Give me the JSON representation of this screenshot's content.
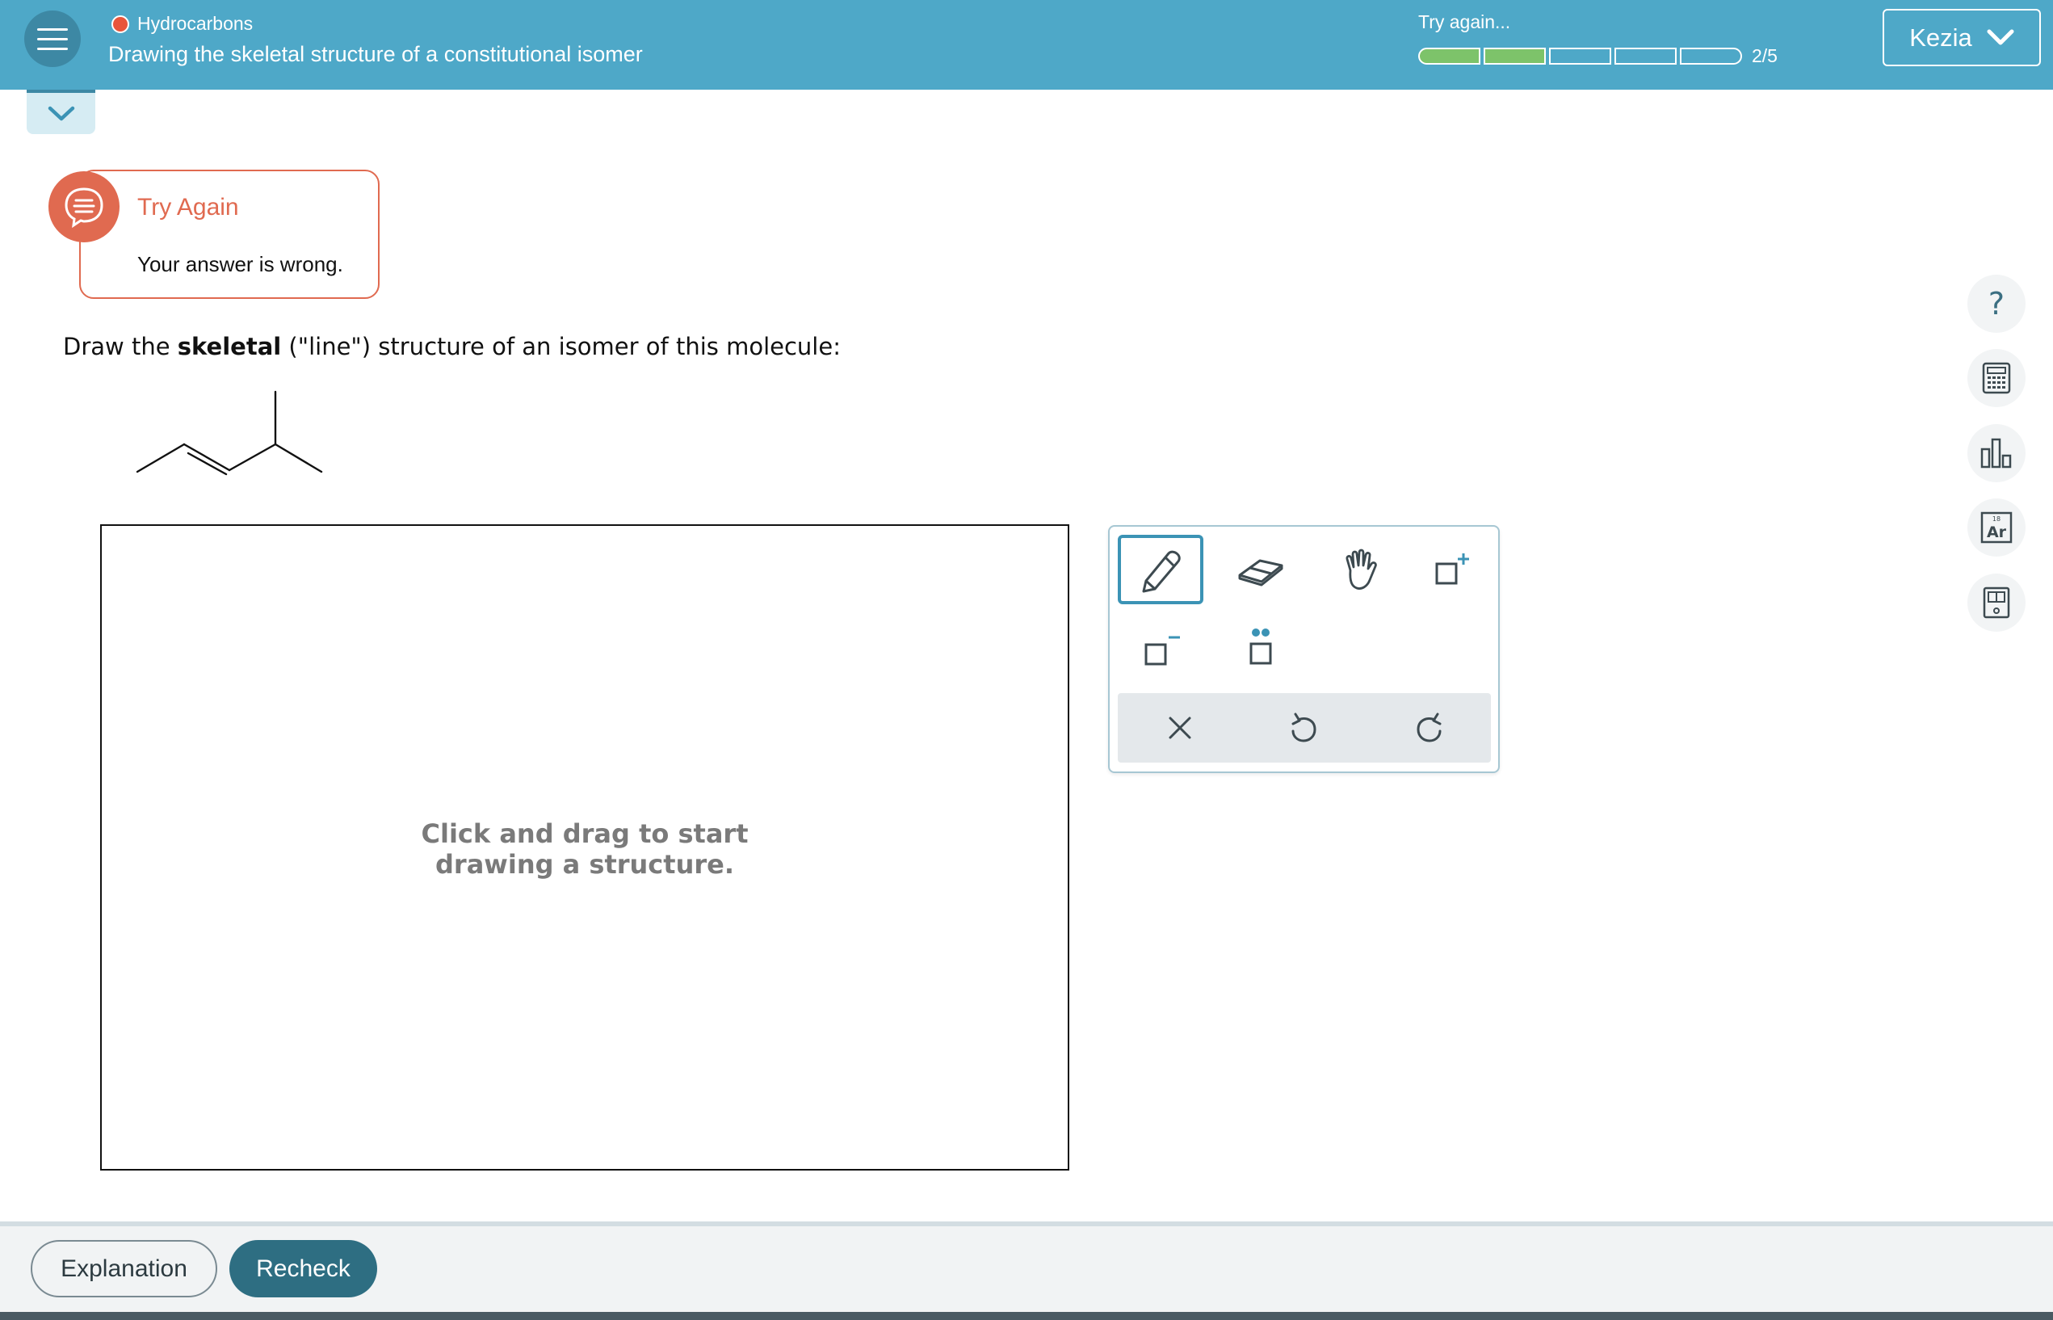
{
  "header": {
    "topic": "Hydrocarbons",
    "title": "Drawing the skeletal structure of a constitutional isomer",
    "progress_status": "Try again...",
    "progress_count": "2/5",
    "progress": {
      "filled": 2,
      "total": 5
    },
    "user_name": "Kezia",
    "colors": {
      "bar": "#4ea8c8",
      "progress_fill": "#7dc36a",
      "status_dot": "#e8553b"
    }
  },
  "feedback": {
    "title": "Try Again",
    "message": "Your answer is wrong.",
    "color": "#e06a50"
  },
  "question": {
    "prefix": "Draw the ",
    "bold": "skeletal",
    "suffix": " (\"line\") structure of an isomer of this molecule:"
  },
  "canvas": {
    "hint": "Click and drag to start drawing a structure."
  },
  "toolbar": {
    "tools": [
      "pencil-icon",
      "eraser-icon",
      "hand-icon",
      "positive-charge-icon",
      "negative-charge-icon",
      "lone-pair-icon"
    ],
    "active_tool": "pencil-icon",
    "actions": [
      "clear-icon",
      "undo-icon",
      "redo-icon"
    ]
  },
  "side_tools": [
    "help-icon",
    "calculator-icon",
    "data-chart-icon",
    "periodic-table-icon",
    "reference-book-icon"
  ],
  "periodic_tile": {
    "number": "18",
    "symbol": "Ar"
  },
  "help_glyph": "?",
  "footer": {
    "explanation_label": "Explanation",
    "recheck_label": "Recheck",
    "accent": "#2e6e82"
  }
}
